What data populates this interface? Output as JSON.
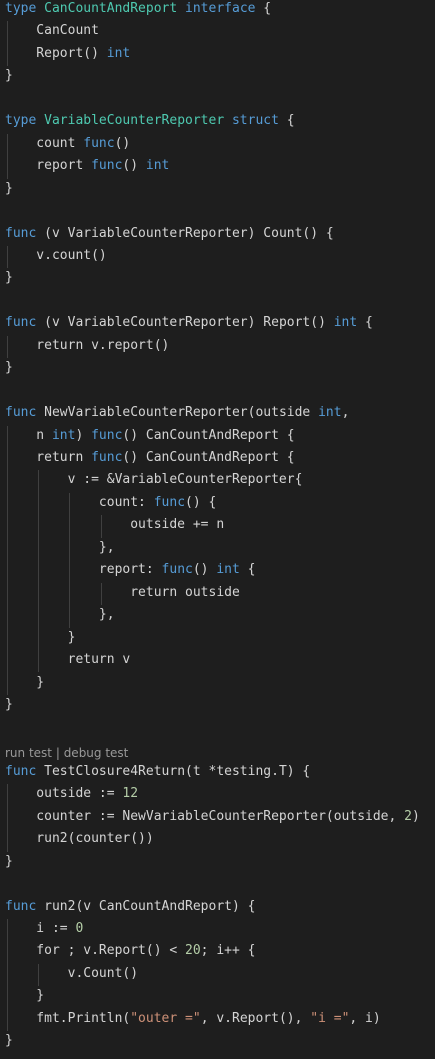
{
  "theme": {
    "background": "#1e1e1e",
    "text": "#d4d4d4",
    "keyword": "#569cd6",
    "type": "#4ec9b0",
    "number": "#b5cea8",
    "string": "#ce9178",
    "indent_guide": "#404040",
    "codelens": "#999999"
  },
  "codelens": {
    "run_label": "run test",
    "separator": " | ",
    "debug_label": "debug test"
  },
  "lines": [
    [
      [
        "type",
        "kw"
      ],
      [
        " ",
        "id"
      ],
      [
        "CanCountAndReport",
        "type"
      ],
      [
        " ",
        "id"
      ],
      [
        "interface",
        "kw"
      ],
      [
        " {",
        "punc"
      ]
    ],
    [
      [
        "    CanCount",
        "id"
      ]
    ],
    [
      [
        "    Report() ",
        "id"
      ],
      [
        "int",
        "kw"
      ]
    ],
    [
      [
        "}",
        "punc"
      ]
    ],
    [],
    [
      [
        "type",
        "kw"
      ],
      [
        " ",
        "id"
      ],
      [
        "VariableCounterReporter",
        "type"
      ],
      [
        " ",
        "id"
      ],
      [
        "struct",
        "kw"
      ],
      [
        " {",
        "punc"
      ]
    ],
    [
      [
        "    count ",
        "id"
      ],
      [
        "func",
        "kw"
      ],
      [
        "()",
        "punc"
      ]
    ],
    [
      [
        "    report ",
        "id"
      ],
      [
        "func",
        "kw"
      ],
      [
        "() ",
        "punc"
      ],
      [
        "int",
        "kw"
      ]
    ],
    [
      [
        "}",
        "punc"
      ]
    ],
    [],
    [
      [
        "func",
        "kw"
      ],
      [
        " (v VariableCounterReporter) Count() {",
        "id"
      ]
    ],
    [
      [
        "    v.count()",
        "id"
      ]
    ],
    [
      [
        "}",
        "punc"
      ]
    ],
    [],
    [
      [
        "func",
        "kw"
      ],
      [
        " (v VariableCounterReporter) Report() ",
        "id"
      ],
      [
        "int",
        "kw"
      ],
      [
        " {",
        "punc"
      ]
    ],
    [
      [
        "    return v.report()",
        "id"
      ]
    ],
    [
      [
        "}",
        "punc"
      ]
    ],
    [],
    [
      [
        "func",
        "kw"
      ],
      [
        " NewVariableCounterReporter(outside ",
        "id"
      ],
      [
        "int",
        "kw"
      ],
      [
        ",",
        "punc"
      ]
    ],
    [
      [
        "    n ",
        "id"
      ],
      [
        "int",
        "kw"
      ],
      [
        ") ",
        "punc"
      ],
      [
        "func",
        "kw"
      ],
      [
        "() CanCountAndReport {",
        "id"
      ]
    ],
    [
      [
        "    return ",
        "id"
      ],
      [
        "func",
        "kw"
      ],
      [
        "() CanCountAndReport {",
        "id"
      ]
    ],
    [
      [
        "        v := &VariableCounterReporter{",
        "id"
      ]
    ],
    [
      [
        "            count: ",
        "id"
      ],
      [
        "func",
        "kw"
      ],
      [
        "() {",
        "punc"
      ]
    ],
    [
      [
        "                outside += n",
        "id"
      ]
    ],
    [
      [
        "            },",
        "punc"
      ]
    ],
    [
      [
        "            report: ",
        "id"
      ],
      [
        "func",
        "kw"
      ],
      [
        "() ",
        "punc"
      ],
      [
        "int",
        "kw"
      ],
      [
        " {",
        "punc"
      ]
    ],
    [
      [
        "                return outside",
        "id"
      ]
    ],
    [
      [
        "            },",
        "punc"
      ]
    ],
    [
      [
        "        }",
        "punc"
      ]
    ],
    [
      [
        "        return v",
        "id"
      ]
    ],
    [
      [
        "    }",
        "punc"
      ]
    ],
    [
      [
        "}",
        "punc"
      ]
    ],
    [],
    [],
    [
      [
        "func",
        "kw"
      ],
      [
        " TestClosure4Return(t *testing.T) {",
        "id"
      ]
    ],
    [
      [
        "    outside := ",
        "id"
      ],
      [
        "12",
        "num"
      ]
    ],
    [
      [
        "    counter := NewVariableCounterReporter(outside, ",
        "id"
      ],
      [
        "2",
        "num"
      ],
      [
        ")",
        "punc"
      ]
    ],
    [
      [
        "    run2(counter())",
        "id"
      ]
    ],
    [
      [
        "}",
        "punc"
      ]
    ],
    [],
    [
      [
        "func",
        "kw"
      ],
      [
        " run2(v CanCountAndReport) {",
        "id"
      ]
    ],
    [
      [
        "    i := ",
        "id"
      ],
      [
        "0",
        "num"
      ]
    ],
    [
      [
        "    for ; v.Report() < ",
        "id"
      ],
      [
        "20",
        "num"
      ],
      [
        "; i++ {",
        "id"
      ]
    ],
    [
      [
        "        v.Count()",
        "id"
      ]
    ],
    [
      [
        "    }",
        "punc"
      ]
    ],
    [
      [
        "    fmt.Println(",
        "id"
      ],
      [
        "\"outer =\"",
        "str"
      ],
      [
        ", v.Report(), ",
        "id"
      ],
      [
        "\"i =\"",
        "str"
      ],
      [
        ", i)",
        "id"
      ]
    ],
    [
      [
        "}",
        "punc"
      ]
    ]
  ]
}
